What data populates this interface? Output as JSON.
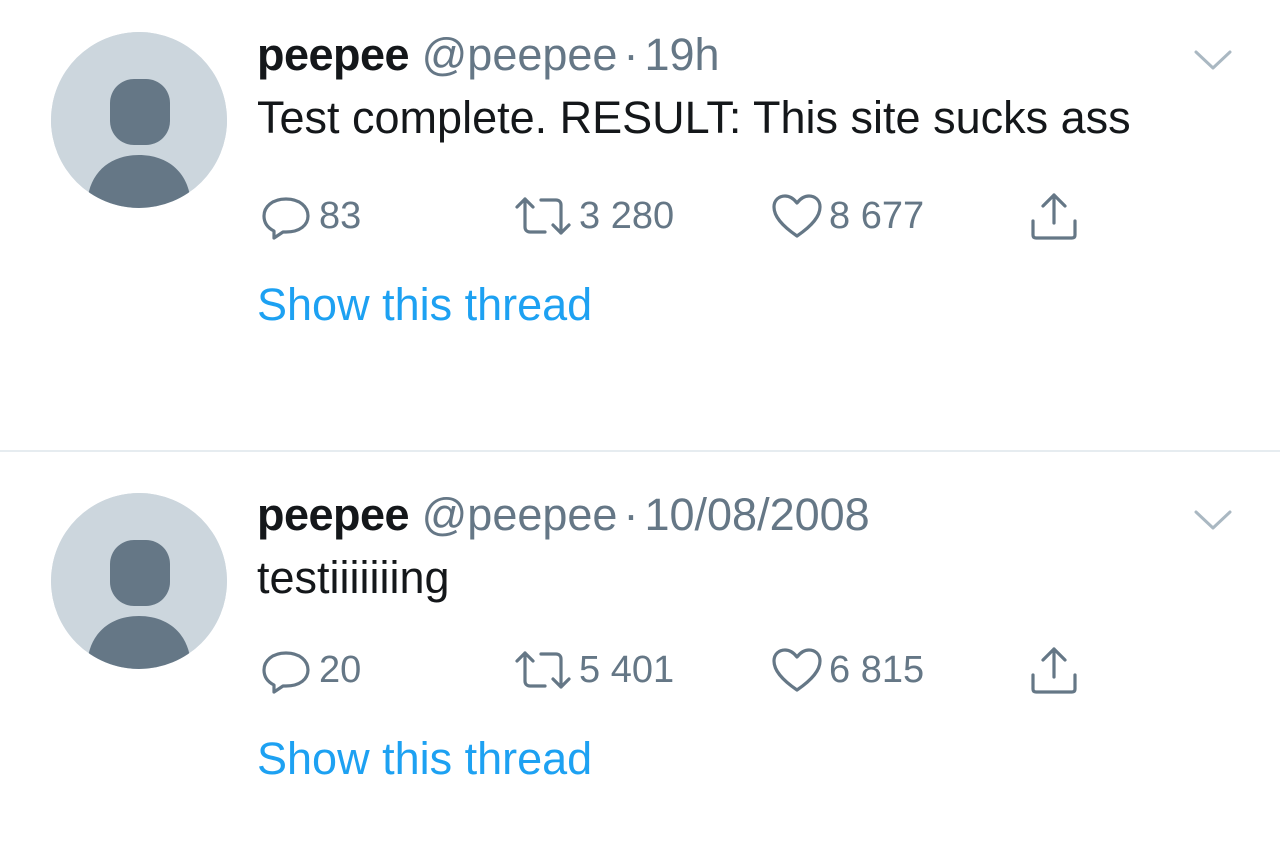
{
  "tweets": [
    {
      "display_name": "peepee",
      "handle": "@peepee",
      "separator": "·",
      "timestamp": "19h",
      "text": "Test complete. RESULT: This site sucks ass",
      "replies": "83",
      "retweets": "3 280",
      "likes": "8 677",
      "show_thread": "Show this thread"
    },
    {
      "display_name": "peepee",
      "handle": "@peepee",
      "separator": "·",
      "timestamp": "10/08/2008",
      "text": "testiiiiiiing",
      "replies": "20",
      "retweets": "5 401",
      "likes": "6 815",
      "show_thread": "Show this thread"
    }
  ],
  "colors": {
    "text_primary": "#14171a",
    "text_secondary": "#657786",
    "link": "#1da1f2",
    "avatar_bg": "#ccd6dd",
    "avatar_fg": "#657786",
    "divider": "#e6ecf0"
  },
  "icons": [
    "default-avatar-icon",
    "reply-icon",
    "retweet-icon",
    "like-icon",
    "share-icon",
    "chevron-down-icon"
  ]
}
